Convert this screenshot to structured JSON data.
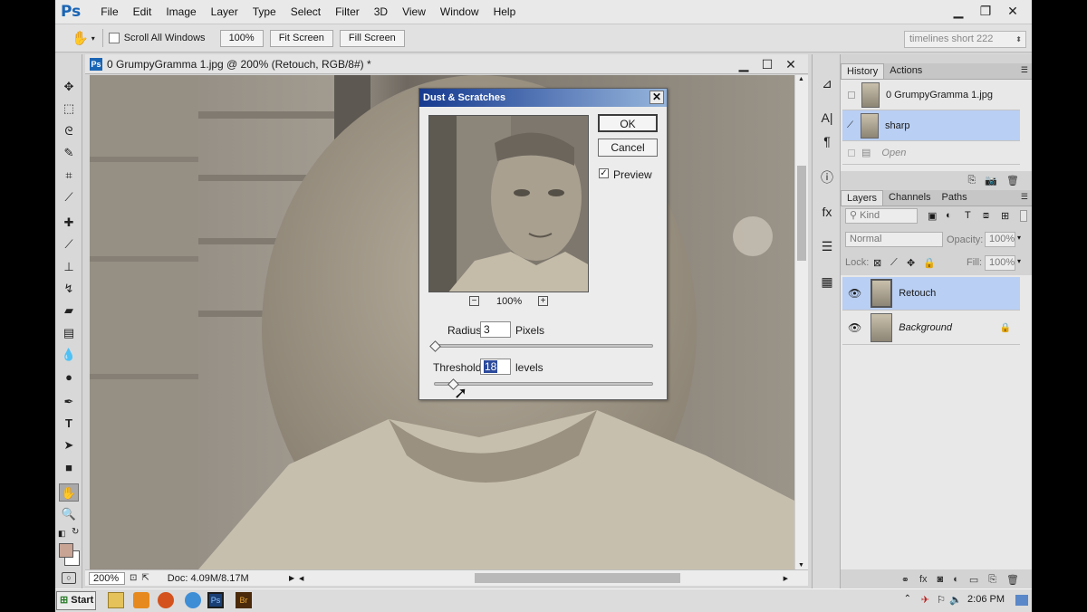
{
  "menubar": {
    "logo": "Ps",
    "items": [
      "File",
      "Edit",
      "Image",
      "Layer",
      "Type",
      "Select",
      "Filter",
      "3D",
      "View",
      "Window",
      "Help"
    ],
    "controls": [
      "▁",
      "❐",
      "✕"
    ]
  },
  "options": {
    "hand_icon": "✋",
    "scroll_all_windows": "Scroll All Windows",
    "btn_100": "100%",
    "btn_fit": "Fit Screen",
    "btn_fill": "Fill Screen",
    "workspace": "timelines short 222"
  },
  "document": {
    "title": "0 GrumpyGramma 1.jpg @ 200% (Retouch, RGB/8#) *",
    "ps_icon": "Ps",
    "controls": [
      "▁",
      "☐",
      "✕"
    ],
    "zoom": "200%",
    "doc_info": "Doc: 4.09M/8.17M"
  },
  "dialog": {
    "title": "Dust & Scratches",
    "close": "✕",
    "ok": "OK",
    "cancel": "Cancel",
    "preview_label": "Preview",
    "preview_checked": "✓",
    "zoom_minus": "−",
    "zoom_level": "100%",
    "zoom_plus": "+",
    "radius_label": "Radius:",
    "radius_value": "3",
    "radius_unit": "Pixels",
    "radius_slider": 0.0,
    "threshold_label": "Threshold:",
    "threshold_value": "18",
    "threshold_unit": "levels",
    "threshold_slider": 0.09
  },
  "history": {
    "tabs": [
      "History",
      "Actions"
    ],
    "rows": [
      {
        "label": "0 GrumpyGramma 1.jpg"
      },
      {
        "label": "sharp"
      },
      {
        "label": "Open"
      }
    ]
  },
  "layers": {
    "tabs": [
      "Layers",
      "Channels",
      "Paths"
    ],
    "kind": "Kind",
    "blend_mode": "Normal",
    "opacity_label": "Opacity:",
    "opacity_value": "100%",
    "lock_label": "Lock:",
    "fill_label": "Fill:",
    "fill_value": "100%",
    "items": [
      {
        "name": "Retouch"
      },
      {
        "name": "Background"
      }
    ]
  },
  "taskbar": {
    "start": "Start",
    "clock": "2:06 PM"
  },
  "colors": {
    "selection": "#b9cff3",
    "dialog_title_start": "#163a8f",
    "foreground_swatch": "#c8a495"
  }
}
